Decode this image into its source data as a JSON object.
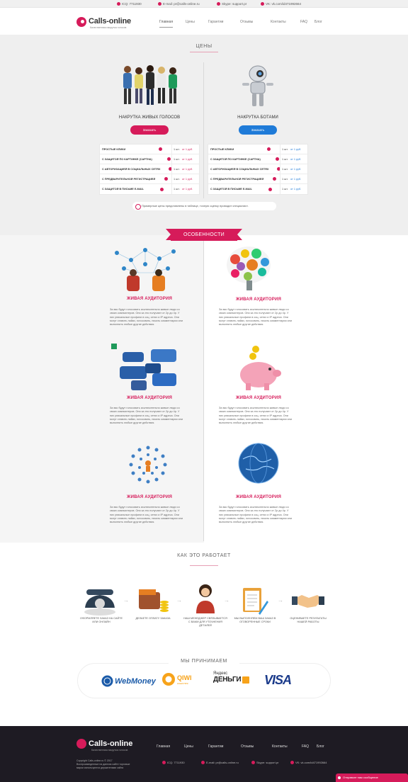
{
  "topbar": {
    "icq": "ICQ: 7711930",
    "email": "E-mail: pr@calls-online.ru",
    "skype": "Skype: support.pr",
    "vk": "VK: vk.com/id471992664"
  },
  "header": {
    "logo": "Calls-online",
    "tagline": "Качественная накрутка голосов",
    "nav": [
      "Главная",
      "Цены",
      "Гарантии",
      "Отзывы",
      "Контакты",
      "FAQ",
      "Блог"
    ]
  },
  "prices": {
    "title": "ЦЕНЫ",
    "left": {
      "title": "НАКРУТКА ЖИВЫХ ГОЛОСОВ",
      "button": "Заказать",
      "rows": [
        {
          "name": "ПРОСТЫЕ КЛИКИ",
          "qty": "1 шт.",
          "price": "от 1 руб."
        },
        {
          "name": "С ЗАЩИТОЙ ПО КАРТИНКЕ (CAPTHA)",
          "qty": "1 шт.",
          "price": "от 1 руб."
        },
        {
          "name": "С АВТОРИЗАЦИЕЙ В СОЦИАЛЬНЫХ СЕТЯХ",
          "qty": "1 шт.",
          "price": "от 1 руб."
        },
        {
          "name": "С ПРЕДВАРИТЕЛЬНОЙ РЕГИСТРАЦИЕЙ",
          "qty": "1 шт.",
          "price": "от 1 руб."
        },
        {
          "name": "С ЗАЩИТОЙ В ПИСЬМЕ E-MAIL",
          "qty": "1 шт.",
          "price": "от 1 руб."
        }
      ]
    },
    "right": {
      "title": "НАКРУТКА БОТАМИ",
      "button": "Заказать",
      "rows": [
        {
          "name": "ПРОСТЫЕ КЛИКИ",
          "qty": "1 шт.",
          "price": "от 1 руб."
        },
        {
          "name": "С ЗАЩИТОЙ ПО КАРТИНКЕ (CAPTHA)",
          "qty": "1 шт.",
          "price": "от 1 руб."
        },
        {
          "name": "С АВТОРИЗАЦИЕЙ В СОЦИАЛЬНЫХ СЕТЯХ",
          "qty": "1 шт.",
          "price": "от 1 руб."
        },
        {
          "name": "С ПРЕДВАРИТЕЛЬНОЙ РЕГИСТРАЦИЕЙ",
          "qty": "1 шт.",
          "price": "от 1 руб."
        },
        {
          "name": "С ЗАЩИТОЙ В ПИСЬМЕ E-MAIL",
          "qty": "1 шт.",
          "price": "от 1 руб."
        }
      ]
    },
    "note": "Примерные цены представлены в таблице, точную оценку проводит специалист."
  },
  "features": {
    "title": "ОСОБЕННОСТИ",
    "items": [
      {
        "title": "ЖИВАЯ АУДИТОРИЯ",
        "text": "За вас будут голосовать исключительно живые люди со своих компьютеров. Они за это получают от 2р до 4р. У них уникальные профили в соц. сетях и IP адреса. Они могут ставить лайки, голосовать, писать комментарии или выполнить любые другие действия."
      },
      {
        "title": "ЖИВАЯ АУДИТОРИЯ",
        "text": "За вас будут голосовать исключительно живые люди со своих компьютеров. Они за это получают от 2р до 4р. У них уникальные профили в соц. сетях и IP адреса. Они могут ставить лайки, голосовать, писать комментарии или выполнить любые другие действия."
      },
      {
        "title": "ЖИВАЯ АУДИТОРИЯ",
        "text": "За вас будут голосовать исключительно живые люди со своих компьютеров. Они за это получают от 2р до 4р. У них уникальные профили в соц. сетях и IP адреса. Они могут ставить лайки, голосовать, писать комментарии или выполнить любые другие действия."
      },
      {
        "title": "ЖИВАЯ АУДИТОРИЯ",
        "text": "За вас будут голосовать исключительно живые люди со своих компьютеров. Они за это получают от 2р до 4р. У них уникальные профили в соц. сетях и IP адреса. Они могут ставить лайки, голосовать, писать комментарии или выполнить любые другие действия."
      },
      {
        "title": "ЖИВАЯ АУДИТОРИЯ",
        "text": "За вас будут голосовать исключительно живые люди со своих компьютеров. Они за это получают от 2р до 4р. У них уникальные профили в соц. сетях и IP адреса. Они могут ставить лайки, голосовать, писать комментарии или выполнить любые другие действия."
      },
      {
        "title": "ЖИВАЯ АУДИТОРИЯ",
        "text": "За вас будут голосовать исключительно живые люди со своих компьютеров. Они за это получают от 2р до 4р. У них уникальные профили в соц. сетях и IP адреса. Они могут ставить лайки, голосовать, писать комментарии или выполнить любые другие действия."
      }
    ]
  },
  "how": {
    "title": "КАК ЭТО РАБОТАЕТ",
    "steps": [
      "Оформляете заказ на сайте или онлайн",
      "Делаете оплату заказа",
      "Наш менеджер связывается с вами для уточнения деталей",
      "Мы выполняем ваш заказ в оговоренные сроки",
      "Оцениваете результаты нашей работы"
    ]
  },
  "payments": {
    "title": "МЫ ПРИНИМАЕМ",
    "webmoney": "WebMoney",
    "qiwi": "QIWI",
    "qiwi_sub": "кошелек",
    "yandex_top": "Яндекс",
    "yandex": "ДЕНЬГИ",
    "visa": "VISA"
  },
  "footer": {
    "logo": "Calls-online",
    "tagline": "Качественная накрутка голосов",
    "copyright": "Copyright Calls-online.ru © 2017",
    "disclaimer": "Воспроизведенные на данном сайте торговые марки используются держателями сайта",
    "nav": [
      "Главная",
      "Цены",
      "Гарантии",
      "Отзывы",
      "Контакты",
      "FAQ",
      "Блог"
    ],
    "icq": "ICQ: 7711930",
    "email": "E-mail: pr@calls-online.ru",
    "skype": "Skype: support.pr",
    "vk": "VK: vk.com/id471992664"
  },
  "chat": {
    "label": "Отправьте нам сообщение"
  },
  "colors": {
    "accent": "#d61b5a",
    "blue": "#1f7bd8",
    "footer": "#1e1b23"
  }
}
